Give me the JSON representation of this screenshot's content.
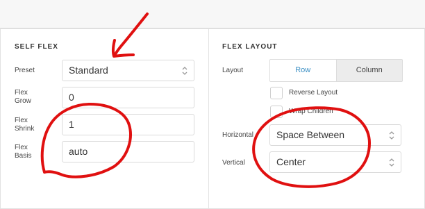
{
  "self_flex": {
    "title": "SELF FLEX",
    "preset_label": "Preset",
    "preset_value": "Standard",
    "grow_label_1": "Flex",
    "grow_label_2": "Grow",
    "grow_value": "0",
    "shrink_label_1": "Flex",
    "shrink_label_2": "Shrink",
    "shrink_value": "1",
    "basis_label_1": "Flex",
    "basis_label_2": "Basis",
    "basis_value": "auto"
  },
  "flex_layout": {
    "title": "FLEX LAYOUT",
    "layout_label": "Layout",
    "row_label": "Row",
    "column_label": "Column",
    "reverse_label": "Reverse Layout",
    "wrap_label": "Wrap Children",
    "horizontal_label": "Horizontal",
    "horizontal_value": "Space Between",
    "vertical_label": "Vertical",
    "vertical_value": "Center"
  },
  "colors": {
    "accent": "#3b8fc4",
    "annotation": "#e01010"
  }
}
